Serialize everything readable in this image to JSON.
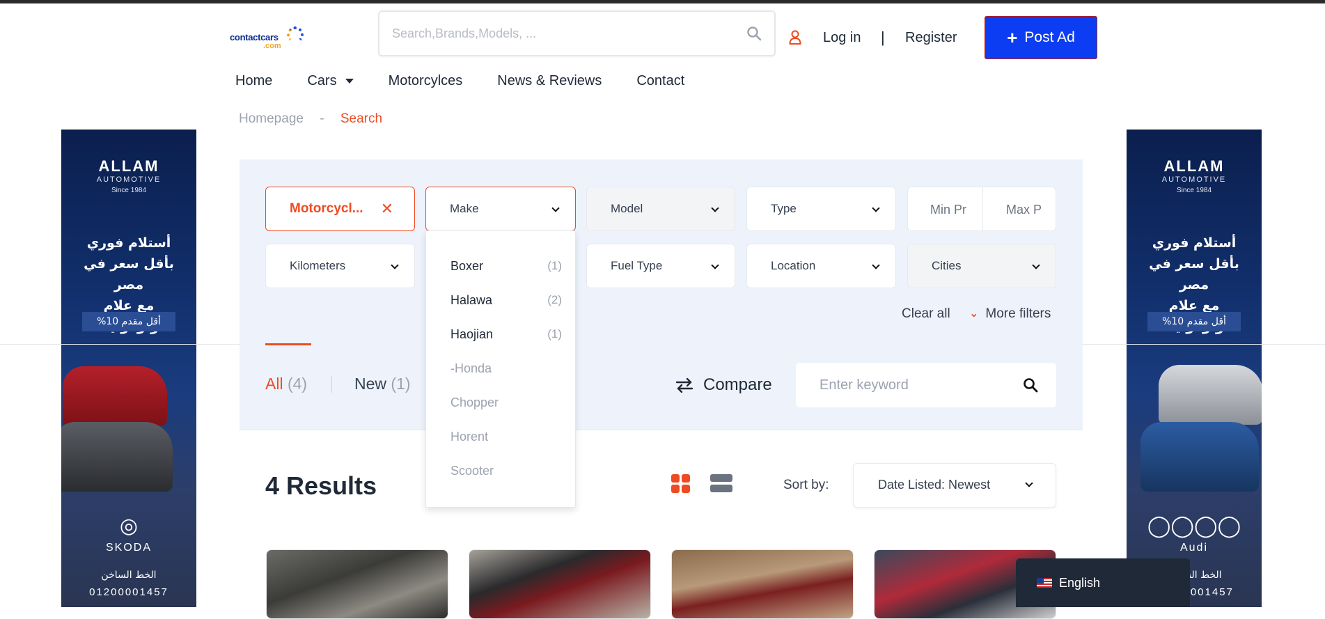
{
  "header": {
    "logo_text_main": "contactcars",
    "logo_text_sub": ".com",
    "search_placeholder": "Search,Brands,Models, ...",
    "login": "Log in",
    "separator": "|",
    "register": "Register",
    "post_ad": "Post Ad"
  },
  "nav": {
    "items": [
      "Home",
      "Cars",
      "Motorcylces",
      "News & Reviews",
      "Contact"
    ]
  },
  "breadcrumb": {
    "home": "Homepage",
    "dash": "-",
    "current": "Search"
  },
  "filters": {
    "selected_chip": "Motorcycl...",
    "make": "Make",
    "model": "Model",
    "type": "Type",
    "min_price": "Min Pr",
    "max_price": "Max P",
    "kilometers": "Kilometers",
    "fuel_type": "Fuel Type",
    "location": "Location",
    "cities": "Cities",
    "clear_all": "Clear all",
    "more_filters": "More filters"
  },
  "make_dropdown": {
    "options": [
      {
        "label": "Boxer",
        "count": "(1)",
        "enabled": true
      },
      {
        "label": "Halawa",
        "count": "(2)",
        "enabled": true
      },
      {
        "label": "Haojian",
        "count": "(1)",
        "enabled": true
      },
      {
        "label": "-Honda",
        "count": "",
        "enabled": false
      },
      {
        "label": "Chopper",
        "count": "",
        "enabled": false
      },
      {
        "label": "Horent",
        "count": "",
        "enabled": false
      },
      {
        "label": "Scooter",
        "count": "",
        "enabled": false
      }
    ]
  },
  "tabs": {
    "all_label": "All",
    "all_count": "(4)",
    "new_label": "New",
    "new_count": "(1)"
  },
  "compare": "Compare",
  "keyword_placeholder": "Enter keyword",
  "results": {
    "title": "4 Results",
    "sort_label": "Sort by:",
    "sort_value": "Date Listed: Newest"
  },
  "banners": {
    "brand": "ALLAM",
    "brand_sub": "AUTOMOTIVE",
    "since": "Since 1984",
    "arabic_1": "أستلام فوري",
    "arabic_2": "بأقل سعر في مصر",
    "arabic_3": "مع علام أوتوموتيف",
    "chip": "أقل مقدم 10%",
    "left_make": "SKODA",
    "right_make": "Audi",
    "hotline_label": "الخط الساخن",
    "phone": "01200001457"
  },
  "language": "English",
  "colors": {
    "accent": "#ef4b22",
    "primary_button": "#0d3df2",
    "panel_bg": "#eef3fb"
  }
}
